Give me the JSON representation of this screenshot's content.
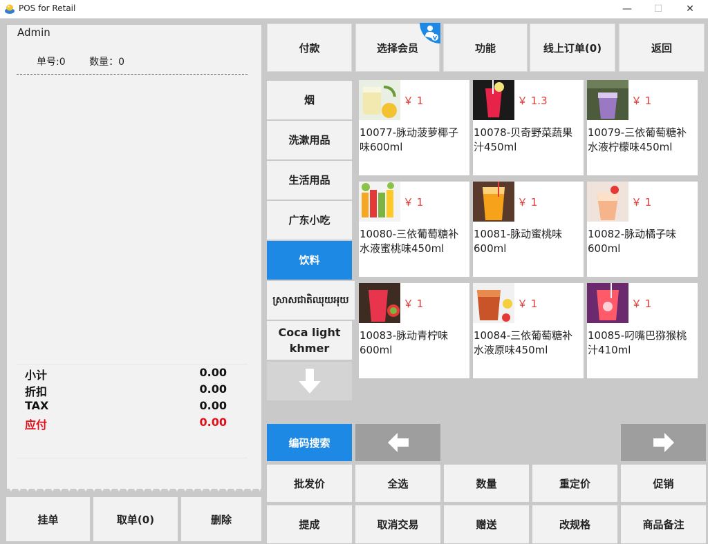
{
  "window": {
    "title": "POS for Retail",
    "minimize": "—",
    "maximize": "☐",
    "close": "✕"
  },
  "receipt": {
    "user": "Admin",
    "order_no": "单号:0",
    "quantity": "数量：0",
    "totals": [
      {
        "label": "小计",
        "value": "0.00"
      },
      {
        "label": "折扣",
        "value": "0.00"
      },
      {
        "label": "TAX",
        "value": "0.00"
      },
      {
        "label": "应付",
        "value": "0.00"
      }
    ]
  },
  "bottom_left_buttons": [
    "挂单",
    "取单(0)",
    "删除"
  ],
  "top_buttons": [
    "付款",
    "选择会员",
    "功能",
    "线上订单(0)",
    "返回"
  ],
  "categories": [
    "烟",
    "洗漱用品",
    "生活用品",
    "广东小吃",
    "饮料",
    "ស្រាសជាតិឈុយអុយ",
    "Coca light khmer"
  ],
  "active_category_index": 4,
  "products": [
    {
      "price": "￥ 1",
      "name": "10077-脉动菠萝椰子味600ml"
    },
    {
      "price": "￥ 1.3",
      "name": "10078-贝奇野菜蔬果汁450ml"
    },
    {
      "price": "￥ 1",
      "name": "10079-三依葡萄糖补水液柠檬味450ml"
    },
    {
      "price": "￥ 1",
      "name": "10080-三依葡萄糖补水液蜜桃味450ml"
    },
    {
      "price": "￥ 1",
      "name": "10081-脉动蜜桃味600ml"
    },
    {
      "price": "￥ 1",
      "name": "10082-脉动橘子味600ml"
    },
    {
      "price": "￥ 1",
      "name": "10083-脉动青柠味600ml"
    },
    {
      "price": "￥ 1",
      "name": "10084-三依葡萄糖补水液原味450ml"
    },
    {
      "price": "￥ 1",
      "name": "10085-叼嘴巴猕猴桃汁410ml"
    }
  ],
  "search": {
    "label": "编码搜索"
  },
  "function_buttons": {
    "row1": [
      "批发价",
      "全选",
      "数量",
      "重定价",
      "促销"
    ],
    "row2": [
      "提成",
      "取消交易",
      "赠送",
      "改规格",
      "商品备注"
    ]
  },
  "colors": {
    "accent": "#1e88e5",
    "price": "#e53935",
    "due": "#e0101a"
  },
  "icons": {
    "app": "pos-app-icon",
    "member": "member-vip-icon",
    "down": "arrow-down-icon",
    "left": "arrow-left-icon",
    "right": "arrow-right-icon"
  }
}
